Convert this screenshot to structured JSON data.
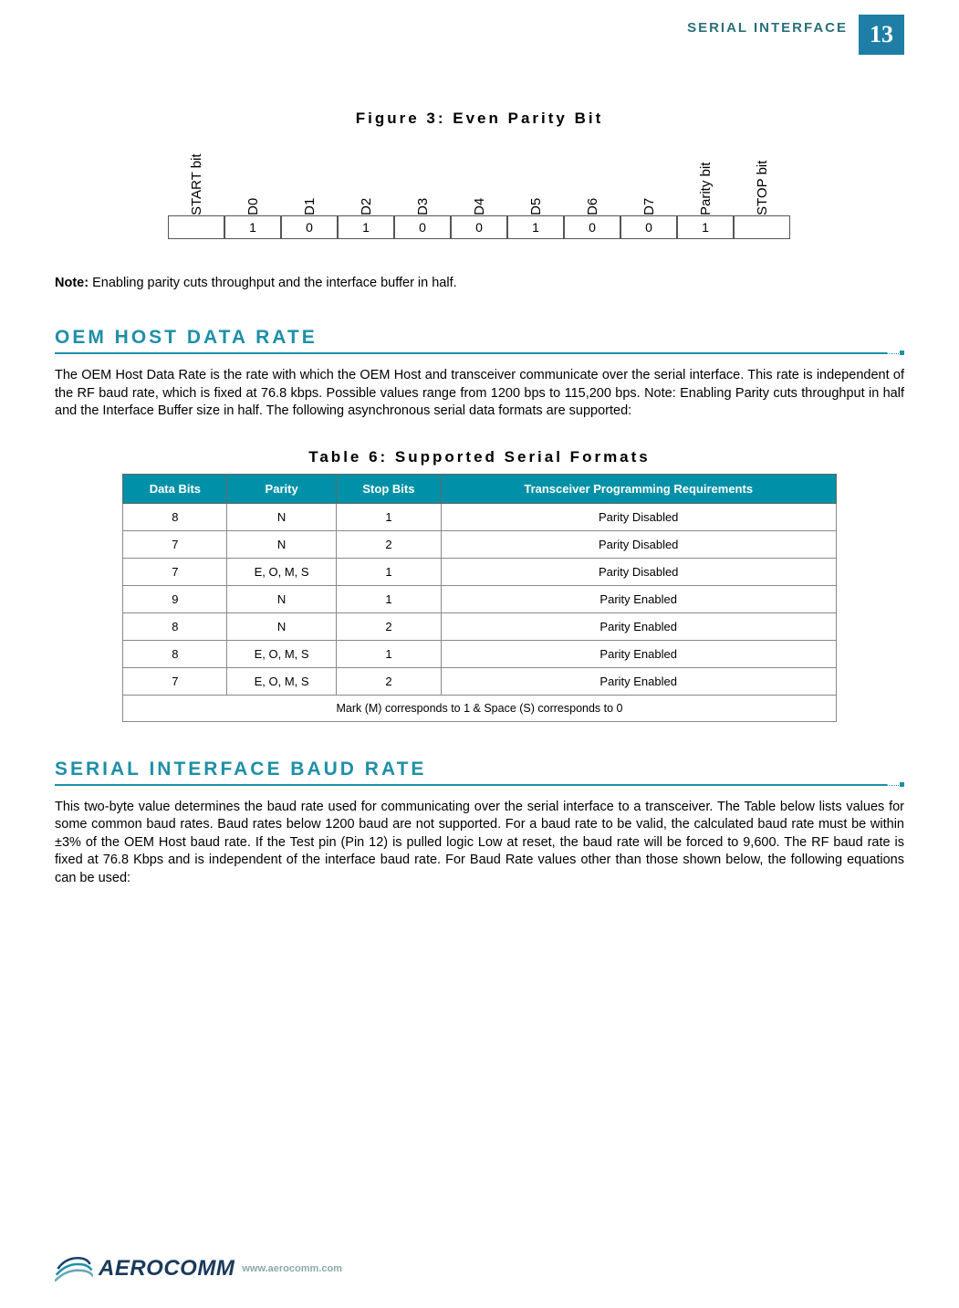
{
  "header": {
    "section_label": "SERIAL INTERFACE",
    "page_number": "13"
  },
  "figure3": {
    "title": "Figure 3: Even Parity Bit",
    "columns": [
      {
        "label": "START bit",
        "value": ""
      },
      {
        "label": "D0",
        "value": "1"
      },
      {
        "label": "D1",
        "value": "0"
      },
      {
        "label": "D2",
        "value": "1"
      },
      {
        "label": "D3",
        "value": "0"
      },
      {
        "label": "D4",
        "value": "0"
      },
      {
        "label": "D5",
        "value": "1"
      },
      {
        "label": "D6",
        "value": "0"
      },
      {
        "label": "D7",
        "value": "0"
      },
      {
        "label": "Parity bit",
        "value": "1"
      },
      {
        "label": "STOP bit",
        "value": ""
      }
    ]
  },
  "note": {
    "prefix": "Note:",
    "text": " Enabling parity cuts throughput and the interface buffer in half."
  },
  "section_oem": {
    "title": "OEM HOST DATA RATE",
    "body": "The OEM Host Data Rate is the rate with which the OEM Host and transceiver communicate over the serial interface. This rate is independent of the RF baud rate, which is fixed at 76.8 kbps.  Possible values range from 1200 bps to 115,200 bps.  Note: Enabling Parity cuts throughput in half and the Interface Buffer size in half.  The following asynchronous serial data formats are supported:"
  },
  "table6": {
    "title": "Table 6: Supported Serial Formats",
    "headers": [
      "Data Bits",
      "Parity",
      "Stop Bits",
      "Transceiver Programming Requirements"
    ],
    "rows": [
      [
        "8",
        "N",
        "1",
        "Parity Disabled"
      ],
      [
        "7",
        "N",
        "2",
        "Parity Disabled"
      ],
      [
        "7",
        "E, O, M, S",
        "1",
        "Parity Disabled"
      ],
      [
        "9",
        "N",
        "1",
        "Parity Enabled"
      ],
      [
        "8",
        "N",
        "2",
        "Parity Enabled"
      ],
      [
        "8",
        "E, O, M, S",
        "1",
        "Parity Enabled"
      ],
      [
        "7",
        "E, O, M, S",
        "2",
        "Parity Enabled"
      ]
    ],
    "footnote": "Mark (M) corresponds to 1 & Space (S) corresponds to 0"
  },
  "section_baud": {
    "title": "SERIAL INTERFACE BAUD RATE",
    "body": "This two-byte value determines the baud rate used for communicating over the serial interface to a transceiver.  The Table below lists values for some common baud rates.  Baud rates below 1200 baud are not supported. For a baud rate to be valid, the calculated baud rate must be within ±3% of the OEM Host baud rate.  If the Test pin (Pin 12) is pulled logic Low at reset, the baud rate will be forced to 9,600.  The RF baud rate is fixed at 76.8 Kbps and is independent of the interface baud rate.  For Baud Rate values other than those shown below, the following equations can be used:"
  },
  "footer": {
    "brand": "AEROCOMM",
    "url": "www.aerocomm.com"
  }
}
